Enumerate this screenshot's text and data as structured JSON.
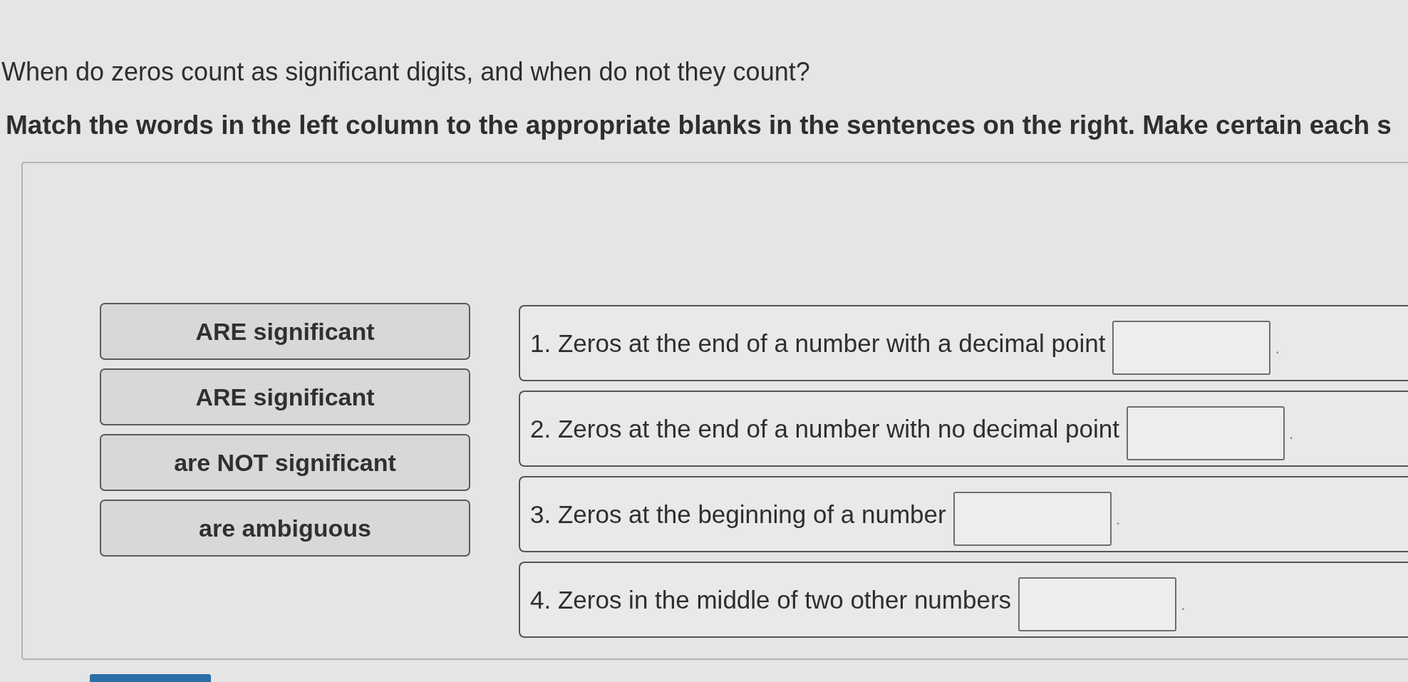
{
  "question": "When do zeros count as significant digits, and when do not they count?",
  "instructions": "Match the words in the left column to the appropriate blanks in the sentences on the right. Make certain each s",
  "word_bank": [
    {
      "label": "ARE significant"
    },
    {
      "label": "ARE significant"
    },
    {
      "label": "are NOT significant"
    },
    {
      "label": "are ambiguous"
    }
  ],
  "sentences": [
    {
      "text": "1. Zeros at the end of a number with a decimal point",
      "suffix": "."
    },
    {
      "text": "2. Zeros at the end of a number with no decimal point",
      "suffix": "."
    },
    {
      "text": "3. Zeros at the beginning of a number",
      "suffix": "."
    },
    {
      "text": "4. Zeros in the middle of two other numbers",
      "suffix": "."
    }
  ]
}
